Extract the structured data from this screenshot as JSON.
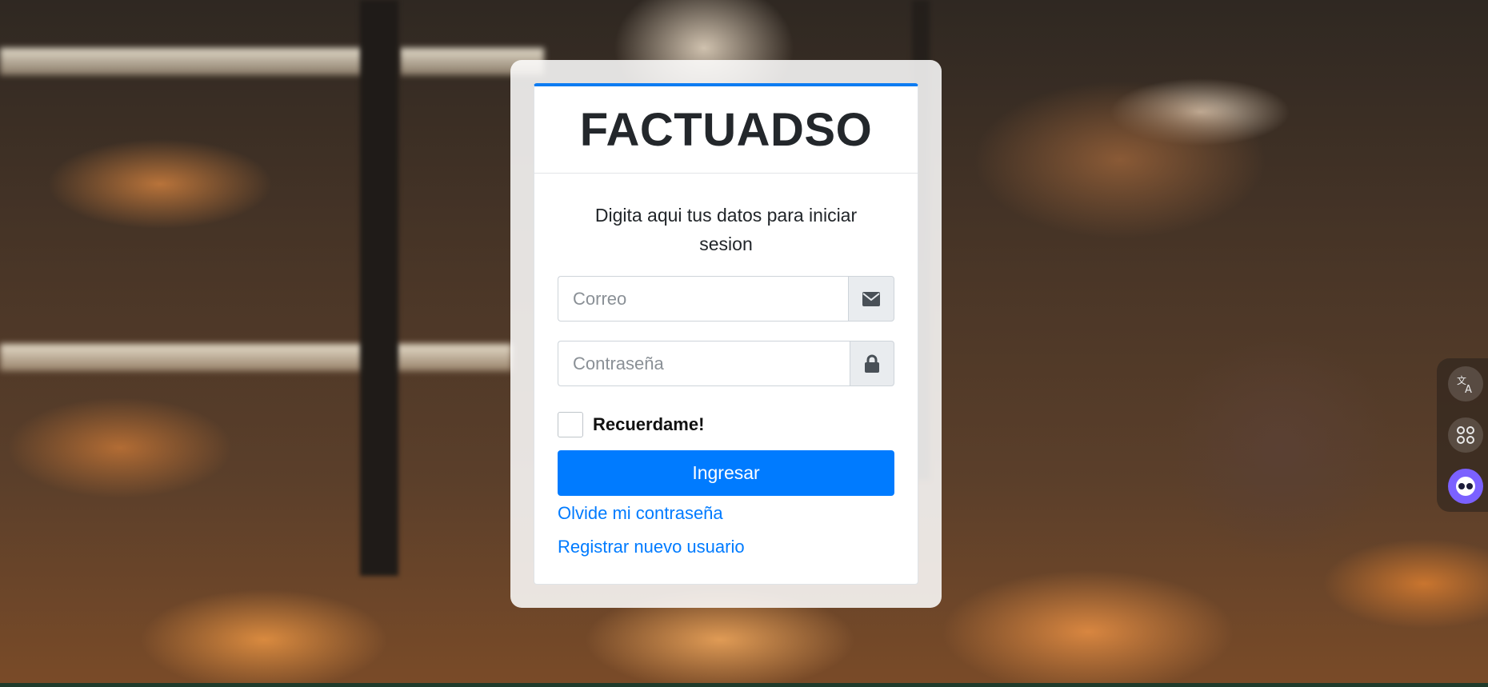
{
  "app": {
    "brand": "FACTUADSO",
    "subtitle": "Digita aqui tus datos para iniciar sesion"
  },
  "form": {
    "email_placeholder": "Correo",
    "password_placeholder": "Contraseña",
    "remember_label": "Recuerdame!",
    "submit_label": "Ingresar",
    "forgot_link": "Olvide mi contraseña",
    "register_link": "Registrar nuevo usuario"
  },
  "icons": {
    "email": "envelope-icon",
    "password": "lock-icon",
    "side_tools": [
      "translate-icon",
      "apps-grid-icon",
      "assistant-avatar-icon"
    ]
  },
  "colors": {
    "accent": "#007bff",
    "card_top_border": "#0d7cf2",
    "brand_text": "#23272b"
  }
}
